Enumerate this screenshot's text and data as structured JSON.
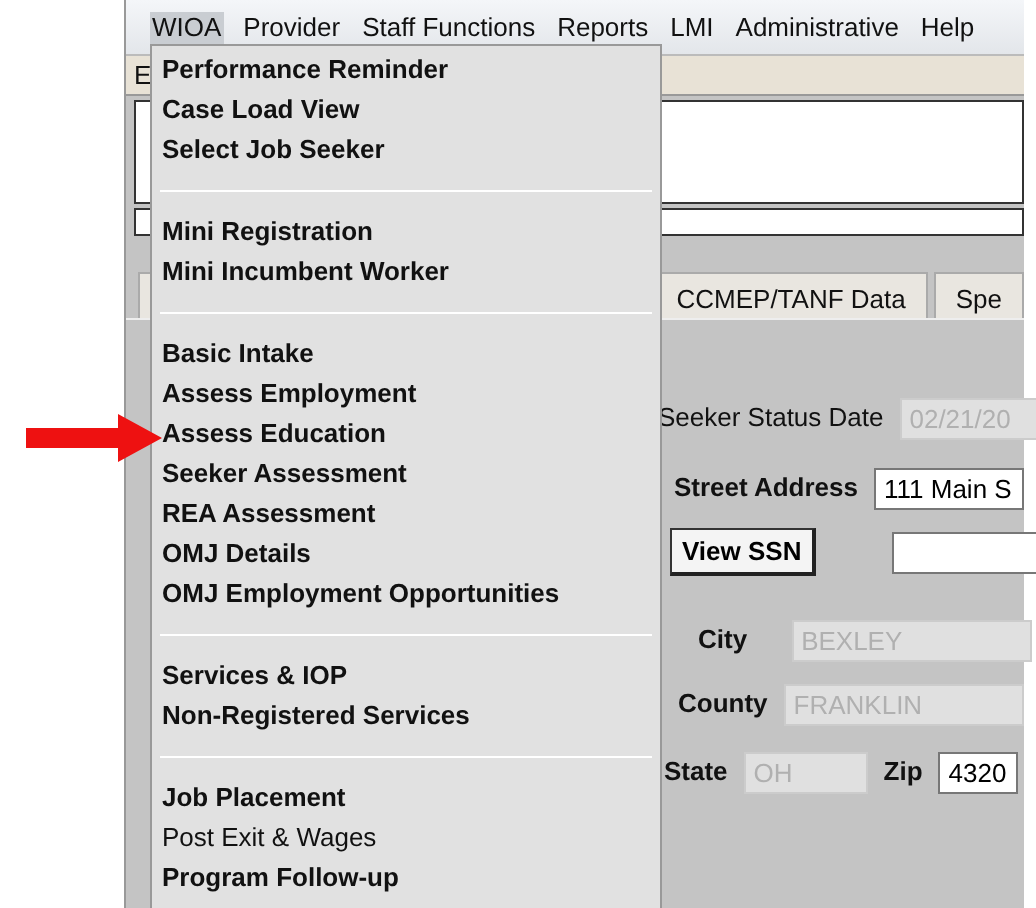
{
  "menu_bar": [
    {
      "label": "WIOA",
      "selected": true
    },
    {
      "label": "Provider",
      "selected": false
    },
    {
      "label": "Staff Functions",
      "selected": false
    },
    {
      "label": "Reports",
      "selected": false
    },
    {
      "label": "LMI",
      "selected": false
    },
    {
      "label": "Administrative",
      "selected": false
    },
    {
      "label": "Help",
      "selected": false
    }
  ],
  "panel": {
    "title": "E"
  },
  "tabs": [
    {
      "label": "CCMEP/TANF Data",
      "selected": false
    },
    {
      "label": "Spe",
      "selected": false
    }
  ],
  "form": {
    "status_date": {
      "label": "Seeker Status Date",
      "value": "02/21/20",
      "disabled": true
    },
    "street_address": {
      "label": "Street Address",
      "value": "111 Main S",
      "disabled": false
    },
    "view_ssn": {
      "label": "View SSN"
    },
    "city": {
      "label": "City",
      "value": "BEXLEY",
      "disabled": true
    },
    "county": {
      "label": "County",
      "value": "FRANKLIN",
      "disabled": true
    },
    "state": {
      "label": "State",
      "value": "OH",
      "disabled": true
    },
    "zip": {
      "label": "Zip",
      "value": "4320",
      "disabled": false
    }
  },
  "dropdown": {
    "sections": [
      [
        {
          "label": "Performance Reminder",
          "bold": true
        },
        {
          "label": "Case Load View",
          "bold": true
        },
        {
          "label": "Select Job Seeker",
          "bold": true
        }
      ],
      [
        {
          "label": "Mini Registration",
          "bold": true
        },
        {
          "label": "Mini Incumbent Worker",
          "bold": true
        }
      ],
      [
        {
          "label": "Basic Intake",
          "bold": true
        },
        {
          "label": "Assess Employment",
          "bold": true
        },
        {
          "label": "Assess Education",
          "bold": true
        },
        {
          "label": "Seeker Assessment",
          "bold": true
        },
        {
          "label": "REA Assessment",
          "bold": true
        },
        {
          "label": "OMJ Details",
          "bold": true
        },
        {
          "label": "OMJ Employment Opportunities",
          "bold": true
        }
      ],
      [
        {
          "label": "Services & IOP",
          "bold": true
        },
        {
          "label": "Non-Registered Services",
          "bold": true
        }
      ],
      [
        {
          "label": "Job Placement",
          "bold": true
        },
        {
          "label": "Post Exit & Wages",
          "bold": false
        },
        {
          "label": "Program Follow-up",
          "bold": true
        }
      ]
    ]
  }
}
